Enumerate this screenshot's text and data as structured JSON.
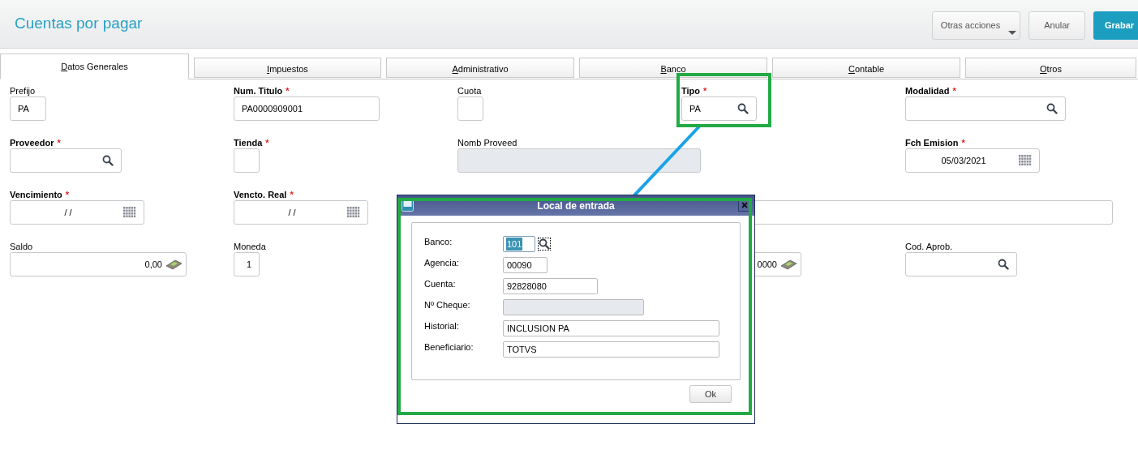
{
  "header": {
    "title": "Cuentas por pagar",
    "buttons": [
      {
        "kind": "menu",
        "label": "Otras acciones"
      },
      {
        "kind": "plain",
        "label": "Anular"
      },
      {
        "kind": "primary",
        "label": "Grabar"
      }
    ]
  },
  "tabs": [
    {
      "label": "Datos Generales",
      "selected": true
    },
    {
      "label": "Impuestos",
      "selected": false
    },
    {
      "label": "Administrativo",
      "selected": false
    },
    {
      "label": "Banco",
      "selected": false
    },
    {
      "label": "Contable",
      "selected": false
    },
    {
      "label": "Otros",
      "selected": false
    }
  ],
  "form_rows": [
    [
      {
        "kind": "text",
        "label": "Prefijo",
        "value": "PA"
      },
      {
        "kind": "text",
        "label": "Num. Titulo",
        "mark": "*",
        "value": "PA0000909001"
      },
      {
        "kind": "text",
        "label": "Cuota"
      },
      {
        "kind": "lookup",
        "label": "Tipo",
        "mark": "*",
        "value": "PA"
      },
      {
        "kind": "lookup",
        "label": "Modalidad",
        "mark": "*"
      }
    ],
    [
      {
        "kind": "lookup",
        "label": "Proveedor",
        "mark": "*"
      },
      {
        "kind": "text",
        "label": "Tienda",
        "mark": "*"
      },
      {
        "kind": "readonly",
        "label": "Nomb Proveed"
      },
      {
        "kind": "blank"
      },
      {
        "kind": "date",
        "label": "Fch Emision",
        "mark": "*",
        "value": "05/03/2021"
      }
    ],
    [
      {
        "kind": "date",
        "label": "Vencimiento",
        "mark": "*",
        "value": "/ /"
      },
      {
        "kind": "date",
        "label": "Vencto. Real",
        "mark": "*",
        "value": "/ /"
      },
      {
        "kind": "blank"
      },
      {
        "kind": "wide"
      }
    ],
    [
      {
        "kind": "currency",
        "label": "Saldo",
        "value": "0,00"
      },
      {
        "kind": "number",
        "label": "Moneda",
        "value": "1"
      },
      {
        "kind": "blank"
      },
      {
        "kind": "currency",
        "value": "0000"
      },
      {
        "kind": "lookup",
        "label": "Cod. Aprob."
      }
    ]
  ],
  "dialog": {
    "title": "Local de entrada",
    "fields": [
      {
        "kind": "lookup",
        "label": "Banco:",
        "value": "101",
        "selected": true
      },
      {
        "kind": "text",
        "label": "Agencia:",
        "value": "00090",
        "selected": false
      },
      {
        "kind": "text",
        "label": "Cuenta:",
        "value": "92828080",
        "selected": false
      },
      {
        "kind": "disabled",
        "label": "Nº Cheque:",
        "selected": false
      },
      {
        "kind": "text",
        "label": "Historial:",
        "value": "INCLUSION PA",
        "selected": false
      },
      {
        "kind": "text",
        "label": "Beneficiario:",
        "value": "TOTVS",
        "selected": false
      }
    ],
    "ok_button": "Ok"
  }
}
